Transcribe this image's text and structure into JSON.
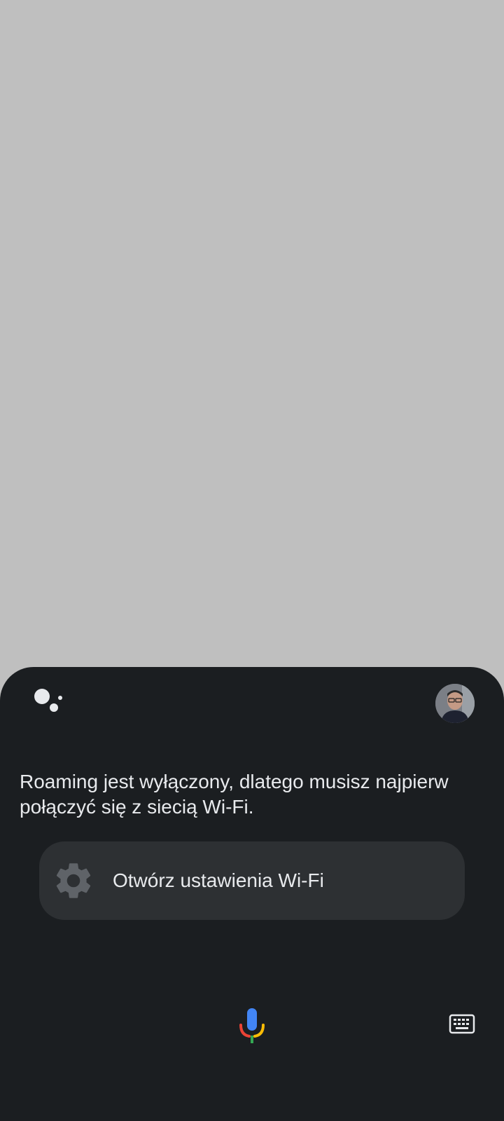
{
  "assistant": {
    "response": "Roaming jest wyłączony, dlatego musisz najpierw połączyć się z siecią Wi-Fi.",
    "action_chip_label": "Otwórz ustawienia Wi-Fi"
  },
  "icons": {
    "logo": "google-assistant-icon",
    "avatar": "user-avatar",
    "chip_icon": "gear-icon",
    "mic": "mic-icon",
    "keyboard": "keyboard-icon"
  },
  "colors": {
    "backdrop": "#bfbfbf",
    "sheet": "#1b1e21",
    "chip": "#2d3033",
    "text": "#e8eaed",
    "gear": "#5f6368",
    "mic_blue": "#4285f4",
    "mic_red": "#ea4335",
    "mic_yellow": "#fbbc05",
    "mic_green": "#34a853"
  }
}
